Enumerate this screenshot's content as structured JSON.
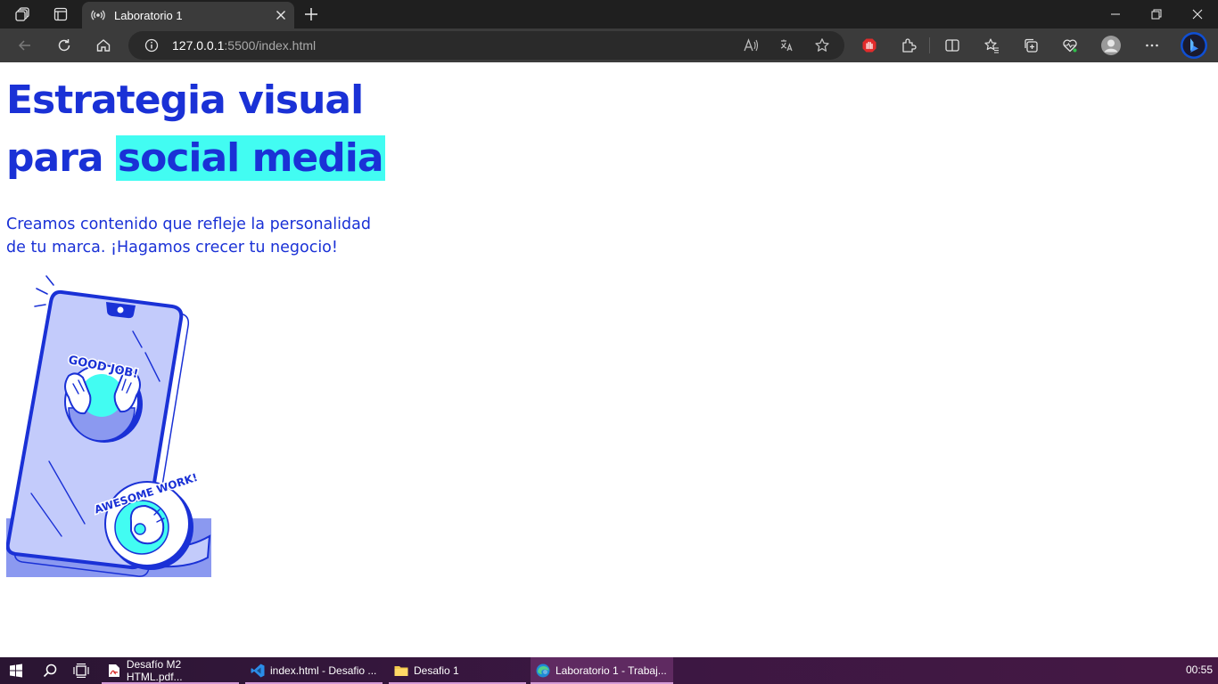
{
  "browser": {
    "tab": {
      "title": "Laboratorio 1",
      "favicon": "broadcast-icon"
    },
    "address": {
      "host": "127.0.0.1",
      "rest": ":5500/index.html"
    }
  },
  "page": {
    "headline_part1": "Estrategia visual",
    "headline_part2": "para",
    "headline_highlight": "social media",
    "subtitle": "Creamos contenido que refleje la personalidad de tu marca. ¡Hagamos crecer tu negocio!",
    "illustration": {
      "sticker_1": "GOOD JOB!",
      "sticker_2": "AWESOME WORK!"
    },
    "colors": {
      "primary": "#1a31d6",
      "highlight": "#42fcf2",
      "phone_fill": "#c3cbfb",
      "accent_purple": "#8b99f0"
    }
  },
  "taskbar": {
    "items": [
      {
        "label": "Desafío M2 HTML.pdf...",
        "icon": "pdf-icon"
      },
      {
        "label": "index.html - Desafio ...",
        "icon": "vscode-icon"
      },
      {
        "label": "Desafio 1",
        "icon": "folder-icon"
      },
      {
        "label": "Laboratorio 1 - Trabaj...",
        "icon": "edge-icon"
      }
    ],
    "clock": "00:55"
  }
}
